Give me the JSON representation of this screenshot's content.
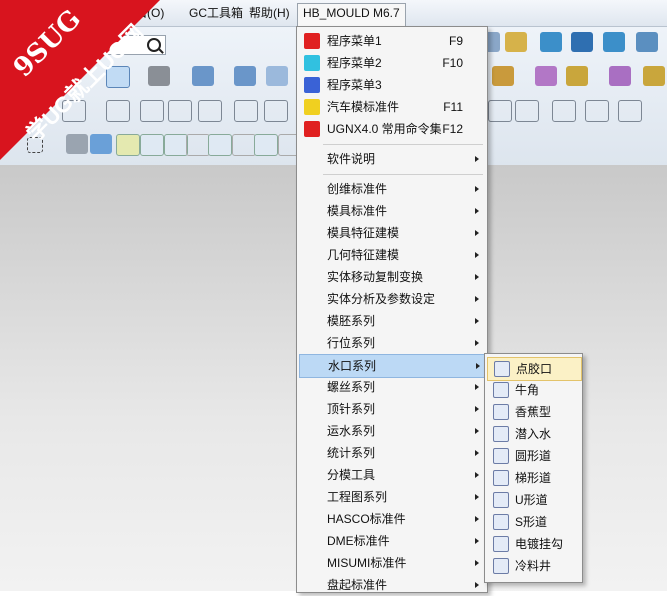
{
  "colors": {
    "watermark": "#d8141e",
    "highlight": "#bcd9f5",
    "sub_highlight": "#fbf1c6"
  },
  "watermark": {
    "line1": "9SUG",
    "line2": "学UG就上UG网"
  },
  "menubar": {
    "items": [
      "口(O)",
      "GC工具箱",
      "帮助(H)",
      "HB_MOULD M6.7"
    ],
    "active": "HB_MOULD M6.7"
  },
  "main_menu": {
    "top_items": [
      {
        "label": "程序菜单1",
        "shortcut": "F9",
        "icon": "taiji-icon"
      },
      {
        "label": "程序菜单2",
        "shortcut": "F10",
        "icon": "taiji-icon"
      },
      {
        "label": "程序菜单3",
        "shortcut": "",
        "icon": "taiji-icon"
      },
      {
        "label": "汽车模标准件",
        "shortcut": "F11",
        "icon": "taiji-icon"
      },
      {
        "label": "UGNX4.0 常用命令集",
        "shortcut": "F12",
        "icon": "taiji-icon"
      }
    ],
    "help_item": {
      "label": "软件说明"
    },
    "items": [
      {
        "label": "创维标准件"
      },
      {
        "label": "模具标准件"
      },
      {
        "label": "模具特征建模"
      },
      {
        "label": "几何特征建模"
      },
      {
        "label": "实体移动复制变换"
      },
      {
        "label": "实体分析及参数设定"
      },
      {
        "label": "模胚系列"
      },
      {
        "label": "行位系列"
      },
      {
        "label": "水口系列"
      },
      {
        "label": "螺丝系列"
      },
      {
        "label": "顶针系列"
      },
      {
        "label": "运水系列"
      },
      {
        "label": "统计系列"
      },
      {
        "label": "分模工具"
      },
      {
        "label": "工程图系列"
      },
      {
        "label": "HASCO标准件"
      },
      {
        "label": "DME标准件"
      },
      {
        "label": "MISUMI标准件"
      },
      {
        "label": "盘起标准件"
      }
    ],
    "highlighted": "水口系列"
  },
  "sub_menu": {
    "items": [
      {
        "label": "点胶口",
        "icon": "pin-gate-icon"
      },
      {
        "label": "牛角",
        "icon": "horn-gate-icon"
      },
      {
        "label": "香蕉型",
        "icon": "banana-gate-icon"
      },
      {
        "label": "潜入水",
        "icon": "sub-gate-icon"
      },
      {
        "label": "圆形道",
        "icon": "round-runner-icon"
      },
      {
        "label": "梯形道",
        "icon": "trapezoid-runner-icon"
      },
      {
        "label": "U形道",
        "icon": "u-runner-icon"
      },
      {
        "label": "S形道",
        "icon": "s-runner-icon"
      },
      {
        "label": "电镀挂勾",
        "icon": "plating-hook-icon"
      },
      {
        "label": "冷料井",
        "icon": "cold-slug-well-icon"
      }
    ],
    "highlighted": "点胶口"
  }
}
